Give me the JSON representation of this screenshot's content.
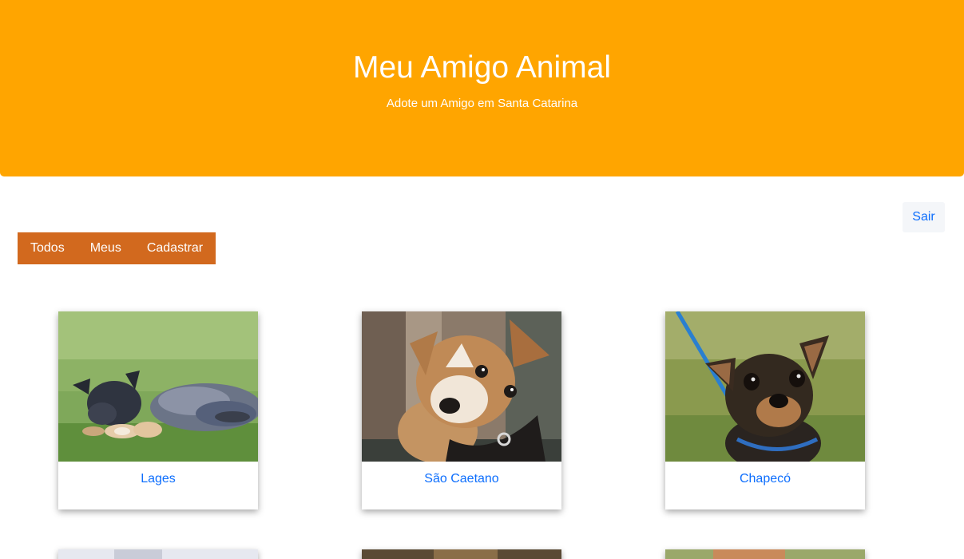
{
  "header": {
    "title": "Meu Amigo Animal",
    "subtitle": "Adote um Amigo em Santa Catarina"
  },
  "actions": {
    "logout_label": "Sair"
  },
  "tabs": [
    {
      "label": "Todos"
    },
    {
      "label": "Meus"
    },
    {
      "label": "Cadastrar"
    }
  ],
  "cards": [
    {
      "city": "Lages",
      "photo": "dog-photo-blue-heeler-puppy"
    },
    {
      "city": "São Caetano",
      "photo": "dog-photo-jack-russell"
    },
    {
      "city": "Chapecó",
      "photo": "dog-photo-chihuahua"
    }
  ],
  "colors": {
    "hero_background": "#ffa500",
    "tab_background": "#d2691e",
    "link": "#0d6efd"
  }
}
